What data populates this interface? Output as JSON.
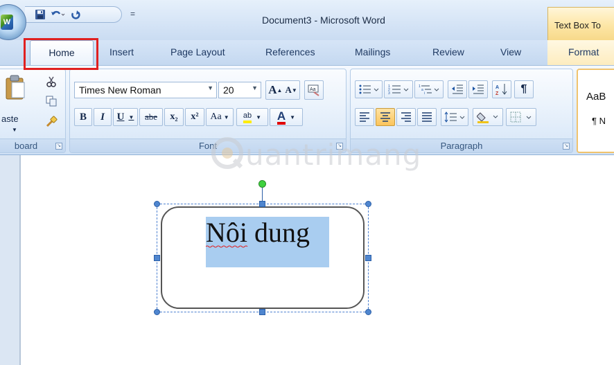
{
  "window": {
    "title": "Document3 - Microsoft Word",
    "context_tab_title": "Text Box To"
  },
  "qat": {
    "customize_label": "="
  },
  "tabs": [
    {
      "label": "Home"
    },
    {
      "label": "Insert"
    },
    {
      "label": "Page Layout"
    },
    {
      "label": "References"
    },
    {
      "label": "Mailings"
    },
    {
      "label": "Review"
    },
    {
      "label": "View"
    },
    {
      "label": "Format"
    }
  ],
  "ribbon": {
    "clipboard": {
      "label": "board",
      "paste_label": "aste"
    },
    "font": {
      "label": "Font",
      "font_name": "Times New Roman",
      "font_size": "20",
      "bold": "B",
      "italic": "I",
      "underline": "U",
      "strikethrough": "abe",
      "subscript": "x₂",
      "superscript": "x²",
      "change_case": "Aa",
      "highlight": "ab",
      "font_color": "A",
      "grow": "A",
      "shrink": "A"
    },
    "paragraph": {
      "label": "Paragraph"
    },
    "styles": {
      "preview": "AaB",
      "normal": "¶ N"
    }
  },
  "document": {
    "textbox_text": "Nôi dung"
  },
  "watermark": {
    "text": "uantrimang"
  },
  "colors": {
    "highlight_red": "#e02020",
    "selection": "#a9cdf0",
    "handle": "#4f86cf",
    "rotate_handle": "#3fd13f"
  }
}
